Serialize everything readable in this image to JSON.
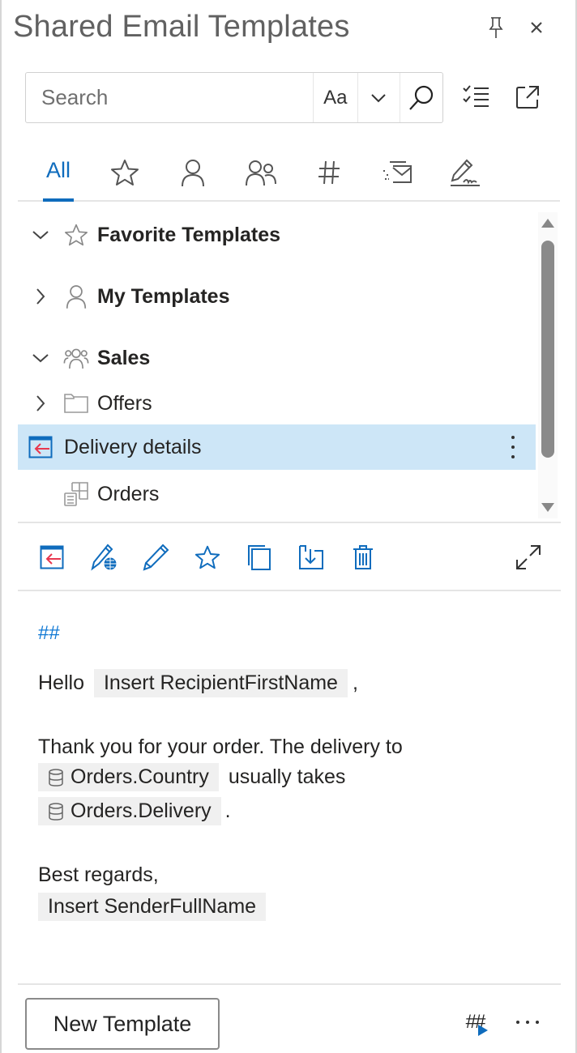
{
  "header": {
    "title": "Shared Email Templates",
    "pin_icon": "pin-icon",
    "close_icon": "close-icon"
  },
  "search": {
    "placeholder": "Search",
    "value": "",
    "match_case_label": "Aa",
    "dropdown_icon": "chevron-down-icon",
    "search_icon": "search-icon"
  },
  "toolbar": {
    "select_icon": "checklist-icon",
    "popout_icon": "open-external-icon"
  },
  "tabs": [
    {
      "label": "All",
      "icon": null,
      "active": true
    },
    {
      "label": "",
      "icon": "star-icon",
      "active": false
    },
    {
      "label": "",
      "icon": "person-icon",
      "active": false
    },
    {
      "label": "",
      "icon": "people-icon",
      "active": false
    },
    {
      "label": "",
      "icon": "hash-icon",
      "active": false
    },
    {
      "label": "",
      "icon": "mail-send-icon",
      "active": false
    },
    {
      "label": "",
      "icon": "signature-icon",
      "active": false
    }
  ],
  "tree": {
    "items": [
      {
        "label": "Favorite Templates",
        "icon": "star-icon",
        "expanded": true,
        "level": 0,
        "bold": true
      },
      {
        "label": "My Templates",
        "icon": "person-icon",
        "expanded": false,
        "level": 0,
        "bold": true
      },
      {
        "label": "Sales",
        "icon": "people-icon",
        "expanded": true,
        "level": 0,
        "bold": true
      },
      {
        "label": "Offers",
        "icon": "folder-icon",
        "expanded": false,
        "level": 1,
        "bold": false
      },
      {
        "label": "Delivery details",
        "icon": "insert-template-icon",
        "selected": true,
        "level": 1,
        "bold": false
      },
      {
        "label": "Orders",
        "icon": "dataset-icon",
        "level": 1,
        "bold": false
      }
    ]
  },
  "actions": [
    {
      "name": "insert",
      "icon": "insert-template-icon"
    },
    {
      "name": "edit-in-browser",
      "icon": "edit-web-icon"
    },
    {
      "name": "edit",
      "icon": "pencil-icon"
    },
    {
      "name": "favorite",
      "icon": "star-icon"
    },
    {
      "name": "copy",
      "icon": "copy-icon"
    },
    {
      "name": "move",
      "icon": "move-to-folder-icon"
    },
    {
      "name": "delete",
      "icon": "trash-icon"
    },
    {
      "name": "expand",
      "icon": "expand-icon"
    }
  ],
  "preview": {
    "marker": "##",
    "greeting": "Hello",
    "recipient_macro": "Insert RecipientFirstName",
    "comma": ",",
    "body_line1": "Thank you for your order. The delivery to",
    "country_field": "Orders.Country",
    "body_mid": "usually takes",
    "delivery_field": "Orders.Delivery",
    "period": ".",
    "closing": "Best regards,",
    "sender_macro": "Insert SenderFullName"
  },
  "footer": {
    "new_template_label": "New Template",
    "macro_icon": "insert-macro-icon",
    "macro_label": "##",
    "more_icon": "more-icon"
  },
  "colors": {
    "accent": "#0f6cbd",
    "selection": "#cde6f7",
    "insert_arrow": "#e8374e"
  }
}
